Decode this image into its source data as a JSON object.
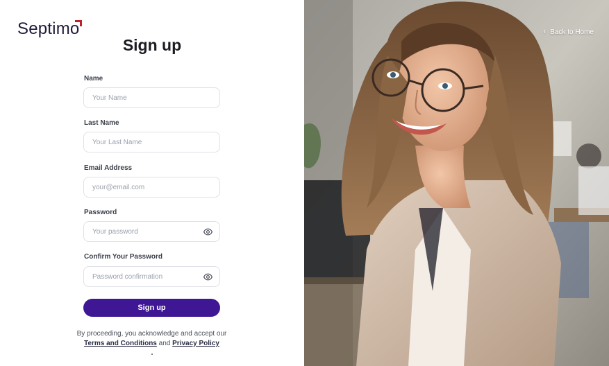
{
  "brand": {
    "name": "Septimo"
  },
  "form": {
    "title": "Sign up",
    "fields": [
      {
        "label": "Name",
        "placeholder": "Your Name"
      },
      {
        "label": "Last Name",
        "placeholder": "Your Last Name"
      },
      {
        "label": "Email Address",
        "placeholder": "your@email.com"
      },
      {
        "label": "Password",
        "placeholder": "Your password",
        "icon": "eye-icon"
      },
      {
        "label": "Confirm Your Password",
        "placeholder": "Password confirmation",
        "icon": "eye-icon"
      }
    ],
    "submit_label": "Sign up",
    "legal": {
      "prefix": "By proceeding, you acknowledge and accept our",
      "terms_link": "Terms and Conditions",
      "and": "and",
      "privacy_link": "Privacy Policy"
    }
  },
  "hero": {
    "back_label": "Back to Home",
    "back_icon": "chevron-left-icon",
    "image_icon": "smiling-woman-photo"
  },
  "colors": {
    "primary": "#3f1694",
    "brand_accent": "#c0202c",
    "text": "#1b1b22"
  }
}
